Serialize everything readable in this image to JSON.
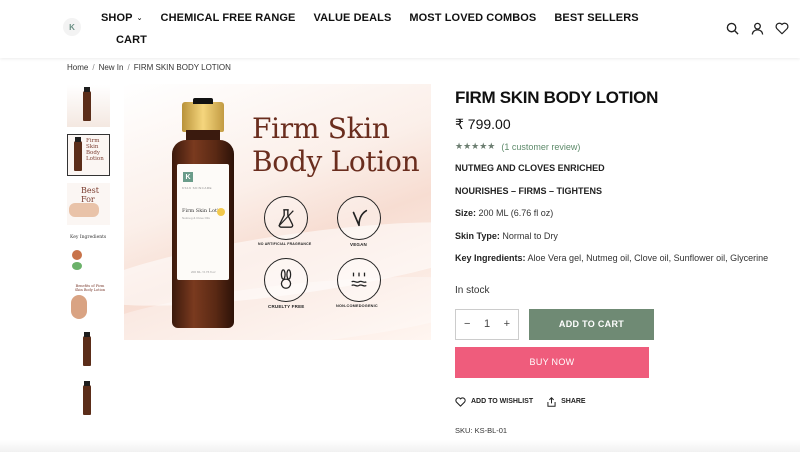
{
  "header": {
    "logo_letter": "K",
    "nav": [
      {
        "label": "SHOP",
        "has_dropdown": true
      },
      {
        "label": "CHEMICAL FREE RANGE"
      },
      {
        "label": "VALUE DEALS"
      },
      {
        "label": "MOST LOVED COMBOS"
      },
      {
        "label": "BEST SELLERS"
      }
    ],
    "nav_row2": "CART",
    "icons": [
      "search-icon",
      "user-icon",
      "heart-icon"
    ]
  },
  "breadcrumb": [
    "Home",
    "New In",
    "FIRM SKIN BODY LOTION"
  ],
  "thumbnails": [
    {
      "name": "bottle-on-fabric"
    },
    {
      "name": "firm-skin-body-lotion-badges",
      "text": "Firm Skin Body Lotion",
      "active": true
    },
    {
      "name": "best-for",
      "text": "Best For"
    },
    {
      "name": "key-ingredients",
      "text": "Key Ingredients"
    },
    {
      "name": "benefits",
      "text": "Benefits of Firm Skin Body Lotion"
    },
    {
      "name": "bottle-front"
    },
    {
      "name": "bottle-back"
    }
  ],
  "main_image": {
    "title_line1": "Firm Skin",
    "title_line2": "Body Lotion",
    "bottle_label": {
      "brand": "KS19 SKINCARE",
      "name": "Firm Skin Lotion",
      "sub": "Nutmeg & Clove Oils",
      "volume": "200 ML / 6.76 fl oz"
    },
    "badges": [
      "NO ARTIFICIAL FRAGRANCE",
      "VEGAN",
      "CRUELTY FREE",
      "NON-COMEDOGENIC"
    ]
  },
  "product": {
    "title": "FIRM SKIN BODY LOTION",
    "price": "₹ 799.00",
    "stars": "★★★★★",
    "rating": 5,
    "review_text": "(1 customer review)",
    "tagline1": "NUTMEG AND CLOVES ENRICHED",
    "tagline2": "NOURISHES – FIRMS – TIGHTENS",
    "size_label": "Size:",
    "size_value": "200 ML (6.76 fl oz)",
    "skin_type_label": "Skin Type:",
    "skin_type_value": "Normal to Dry",
    "ingredients_label": "Key Ingredients:",
    "ingredients_value": "Aloe Vera gel, Nutmeg oil, Clove oil, Sunflower oil, Glycerine",
    "stock": "In stock",
    "quantity": "1",
    "minus": "−",
    "plus": "+",
    "add_to_cart": "ADD TO CART",
    "buy_now": "BUY NOW",
    "wishlist": "ADD TO WISHLIST",
    "share": "SHARE",
    "sku": "SKU: KS-BL-01"
  },
  "colors": {
    "add_to_cart": "#6f8a74",
    "buy_now": "#ef5c7c",
    "title_accent": "#6a2d1e",
    "rating": "#5d8a6a"
  }
}
